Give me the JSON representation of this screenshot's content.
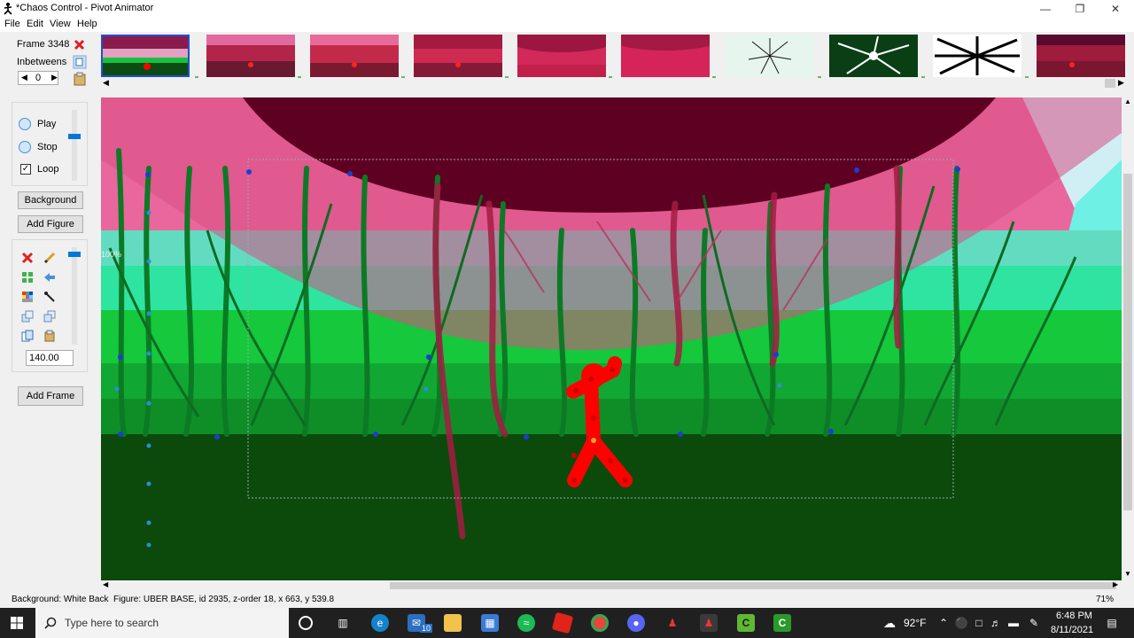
{
  "window": {
    "title": "*Chaos Control - Pivot Animator"
  },
  "menu": [
    "File",
    "Edit",
    "View",
    "Help"
  ],
  "frame_panel": {
    "frame_label": "Frame 3348",
    "inbetweens_label": "Inbetweens",
    "inbetweens_value": "0"
  },
  "playback": {
    "play": "Play",
    "stop": "Stop",
    "loop": "Loop"
  },
  "buttons": {
    "background": "Background",
    "add_figure": "Add Figure",
    "add_frame": "Add Frame"
  },
  "size_value": "140.00",
  "canvas": {
    "zoom_marker": "100%"
  },
  "status": {
    "background": "Background: White Back",
    "figure": "Figure: UBER BASE,  id 2935,  z-order 18,  x 663, y 539.8",
    "zoom": "71%"
  },
  "taskbar": {
    "search_placeholder": "Type here to search",
    "mail_badge": "10",
    "temperature": "92°F",
    "time": "6:48 PM",
    "date": "8/11/2021"
  },
  "colors": {
    "accent": "#1e4fd8",
    "figure": "#ff0000",
    "sky_pink": "#e9679c",
    "dark_green": "#0b4a0b",
    "bright_green": "#10c83c"
  }
}
